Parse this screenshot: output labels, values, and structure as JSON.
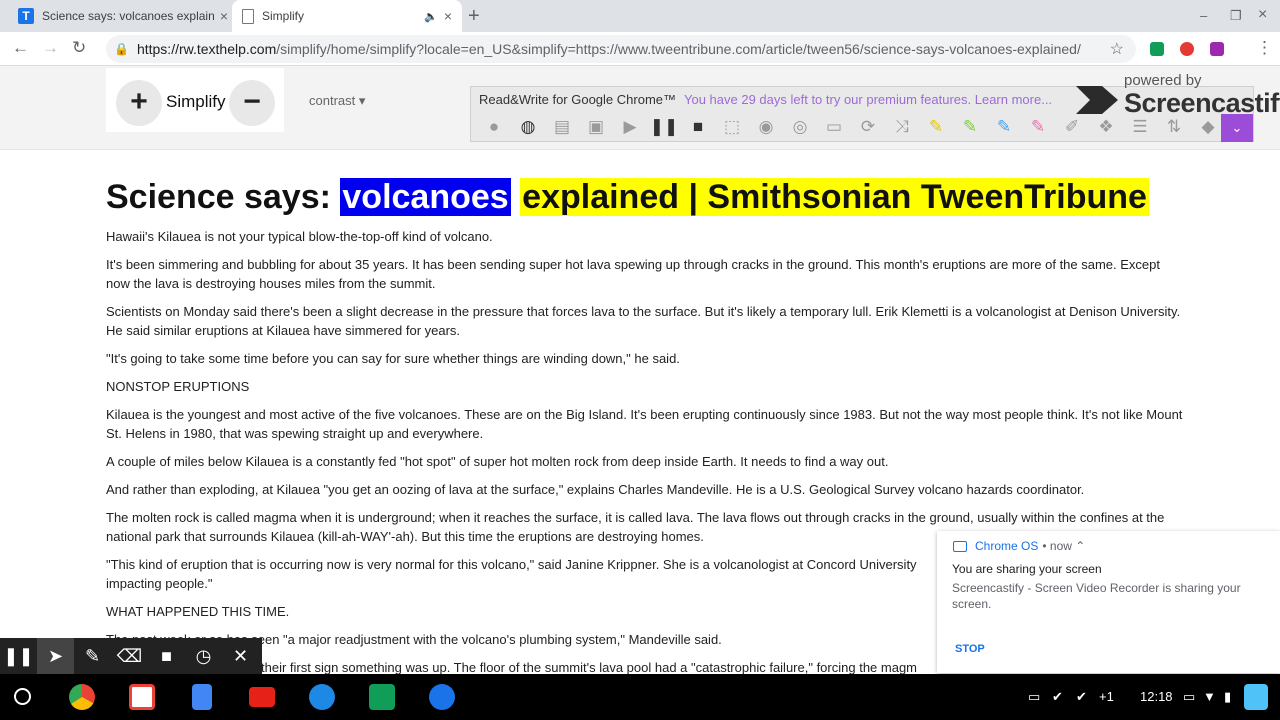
{
  "tabs": [
    {
      "title": "Science says: volcanoes explaine",
      "close": "×"
    },
    {
      "title": "Simplify",
      "audio": "🔈",
      "close": "×"
    }
  ],
  "newtab": "+",
  "window_controls": {
    "minimize": "–",
    "restore": "❐",
    "close": "×"
  },
  "nav": {
    "back": "←",
    "forward": "→",
    "reload": "↻",
    "menu": "⋮"
  },
  "url": {
    "host": "https://rw.texthelp.com",
    "path": "/simplify/home/simplify?locale=en_US&simplify=https://www.tweentribune.com/article/tween56/science-says-volcanoes-explained/"
  },
  "simplify": {
    "plus": "+",
    "label": "Simplify",
    "minus": "−",
    "contrast": "contrast ▾"
  },
  "readwrite": {
    "title": "Read&Write for Google Chrome™",
    "trial": "You have 29 days left to try our premium features. Learn more...",
    "more": "⌄"
  },
  "screencastify": {
    "powered": "powered by",
    "brand": "Screencastify"
  },
  "article": {
    "headline_prefix": "Science says: ",
    "headline_selected": "volcanoes",
    "headline_rest": "explained | Smithsonian TweenTribune",
    "paragraphs": [
      "Hawaii's Kilauea is not your typical blow-the-top-off kind of volcano.",
      "It's been simmering and bubbling for about 35 years. It has been sending super hot lava spewing up through cracks in the ground. This month's eruptions are more of the same. Except now the lava is destroying houses miles from the summit.",
      "Scientists on Monday said there's been a slight decrease in the pressure that forces lava to the surface. But it's likely a temporary lull. Erik Klemetti is a volcanologist at Denison University. He said similar eruptions at Kilauea have simmered for years.",
      "\"It's going to take some time before you can say for sure whether things are winding down,\" he said.",
      "NONSTOP ERUPTIONS",
      "Kilauea is the youngest and most active of the five volcanoes. These are on the Big Island. It's been erupting continuously since 1983. But not the way most people think. It's not like Mount St. Helens in 1980, that was spewing straight up and everywhere.",
      "A couple of miles below Kilauea is a constantly fed \"hot spot\" of super hot molten rock from deep inside Earth. It needs to find a way out.",
      "And rather than exploding, at Kilauea \"you get an oozing of lava at the surface,\" explains Charles Mandeville. He is a U.S. Geological Survey volcano hazards coordinator.",
      "The molten rock is called magma when it is underground; when it reaches the surface, it is called lava. The lava flows out through cracks in the ground, usually within the confines at the national park that surrounds Kilauea (kill-ah-WAY'-ah). But this time the eruptions are destroying homes.",
      "\"This kind of eruption that is occurring now is very normal for this volcano,\" said Janine Krippner. She is a volcanologist at Concord University impacting people.\"",
      "WHAT HAPPENED THIS TIME.",
      "The past week or so has seen \"a major readjustment with the volcano's plumbing system,\" Mandeville said.",
      "their first sign something was up. The floor of the summit's lava pool had a \"catastrophic failure,\" forcing the magm"
    ]
  },
  "notification": {
    "source": "Chrome OS",
    "time": "• now ⌃",
    "title": "You are sharing your screen",
    "body": "Screencastify - Screen Video Recorder is sharing your screen.",
    "action": "STOP"
  },
  "tray": {
    "time": "12:18",
    "more_count": "+1"
  }
}
